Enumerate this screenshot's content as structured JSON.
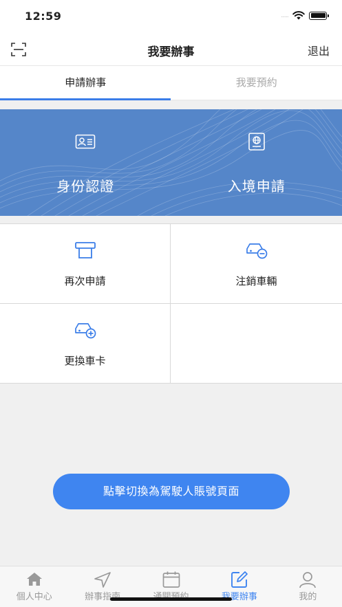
{
  "status_bar": {
    "time": "12:59",
    "signal": "....."
  },
  "nav": {
    "title": "我要辦事",
    "exit_label": "退出"
  },
  "tabs": [
    {
      "label": "申請辦事",
      "active": true
    },
    {
      "label": "我要預約",
      "active": false
    }
  ],
  "banner": {
    "color": "#5586c9",
    "items": [
      {
        "label": "身份認證",
        "icon": "id-card-icon"
      },
      {
        "label": "入境申請",
        "icon": "passport-icon"
      }
    ]
  },
  "grid": [
    {
      "label": "再次申請",
      "icon": "reapply-icon"
    },
    {
      "label": "注銷車輛",
      "icon": "car-minus-icon"
    },
    {
      "label": "更換車卡",
      "icon": "car-plus-icon"
    }
  ],
  "switch_button": {
    "label": "點擊切換為駕駛人賬號頁面",
    "color": "#3f85f0"
  },
  "tabbar": [
    {
      "label": "個人中心",
      "icon": "home-icon",
      "active": false
    },
    {
      "label": "辦事指南",
      "icon": "navigation-icon",
      "active": false
    },
    {
      "label": "通關預約",
      "icon": "calendar-icon",
      "active": false
    },
    {
      "label": "我要辦事",
      "icon": "edit-icon",
      "active": true
    },
    {
      "label": "我的",
      "icon": "user-icon",
      "active": false
    }
  ]
}
